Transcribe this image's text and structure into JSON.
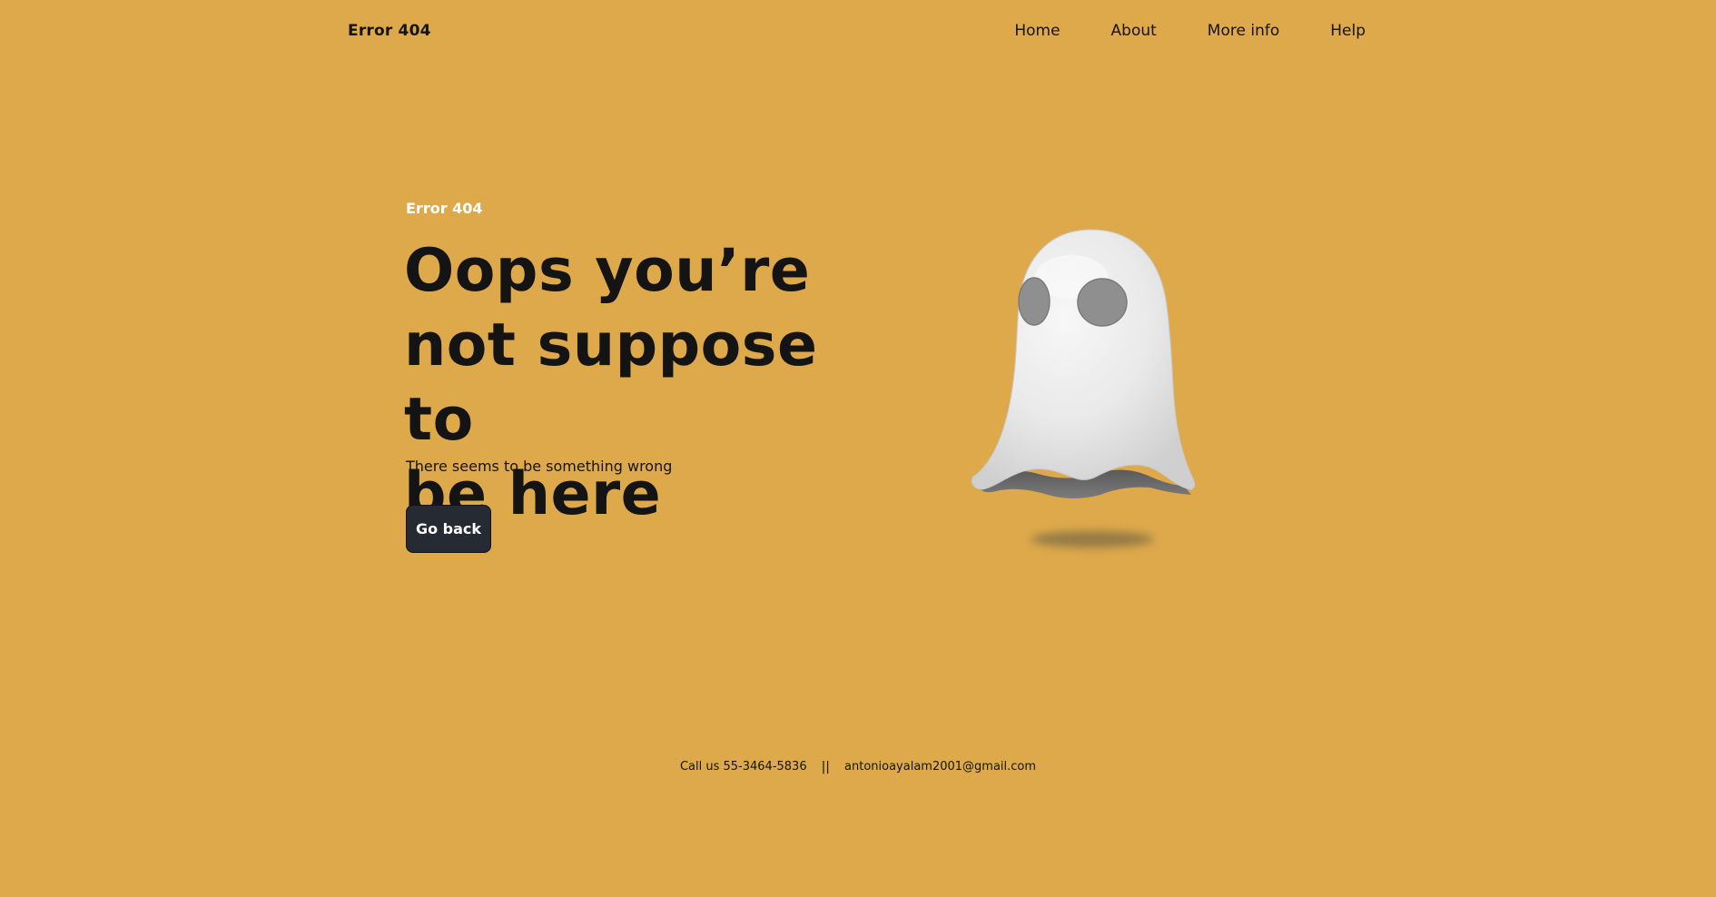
{
  "header": {
    "brand": "Error 404",
    "nav": [
      {
        "label": "Home"
      },
      {
        "label": "About"
      },
      {
        "label": "More info"
      },
      {
        "label": "Help"
      }
    ]
  },
  "hero": {
    "eyebrow": "Error 404",
    "headline_lines": [
      "Oops you’re",
      "not suppose to",
      "be here"
    ],
    "subtext": "There seems to be something wrong",
    "button_label": "Go back"
  },
  "illustration": {
    "name": "ghost-illustration"
  },
  "footer": {
    "phone": "Call us 55-3464-5836",
    "separator": "||",
    "email": "antonioayalam2001@gmail.com"
  },
  "colors": {
    "background": "#dea94b",
    "button": "#262a33",
    "text": "#141414",
    "eyebrow": "#ffffff"
  }
}
